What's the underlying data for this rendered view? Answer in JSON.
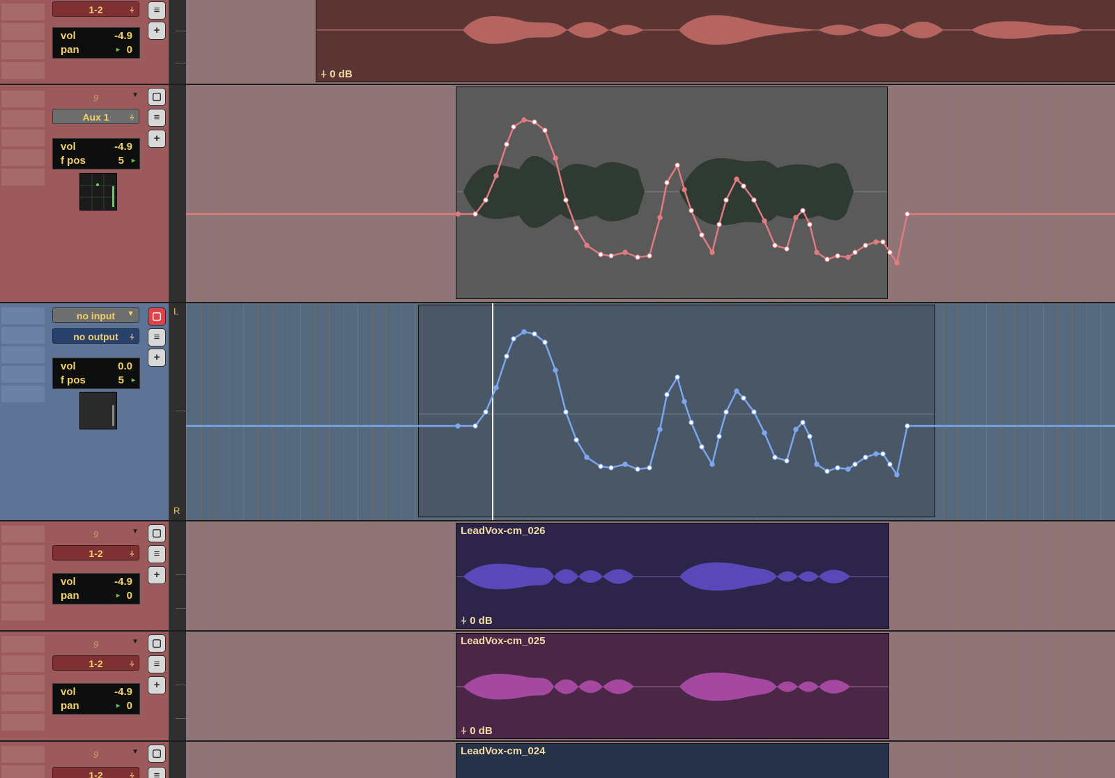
{
  "colors": {
    "red_track": "#9d5a5c",
    "blue_track": "#5d7496",
    "auto_red": "#e07b7f",
    "auto_blue": "#7aa7ee"
  },
  "tracks": [
    {
      "output": "1-2",
      "vol_label": "vol",
      "vol": "-4.9",
      "pan_label": "pan",
      "pan": "0",
      "gain": "0 dB"
    },
    {
      "voice": "9",
      "send": "Aux 1",
      "vol_label": "vol",
      "vol": "-4.9",
      "pos_label": "f pos",
      "pos": "5"
    },
    {
      "input": "no input",
      "output": "no output",
      "vol_label": "vol",
      "vol": "0.0",
      "pos_label": "f pos",
      "pos": "5",
      "left": "L",
      "right": "R"
    },
    {
      "voice": "9",
      "output": "1-2",
      "vol_label": "vol",
      "vol": "-4.9",
      "pan_label": "pan",
      "pan": "0",
      "region": "LeadVox-cm_026",
      "gain": "0 dB"
    },
    {
      "voice": "9",
      "output": "1-2",
      "vol_label": "vol",
      "vol": "-4.9",
      "pan_label": "pan",
      "pan": "0",
      "region": "LeadVox-cm_025",
      "gain": "0 dB"
    },
    {
      "voice": "9",
      "output": "1-2",
      "region": "LeadVox-cm_024"
    }
  ]
}
